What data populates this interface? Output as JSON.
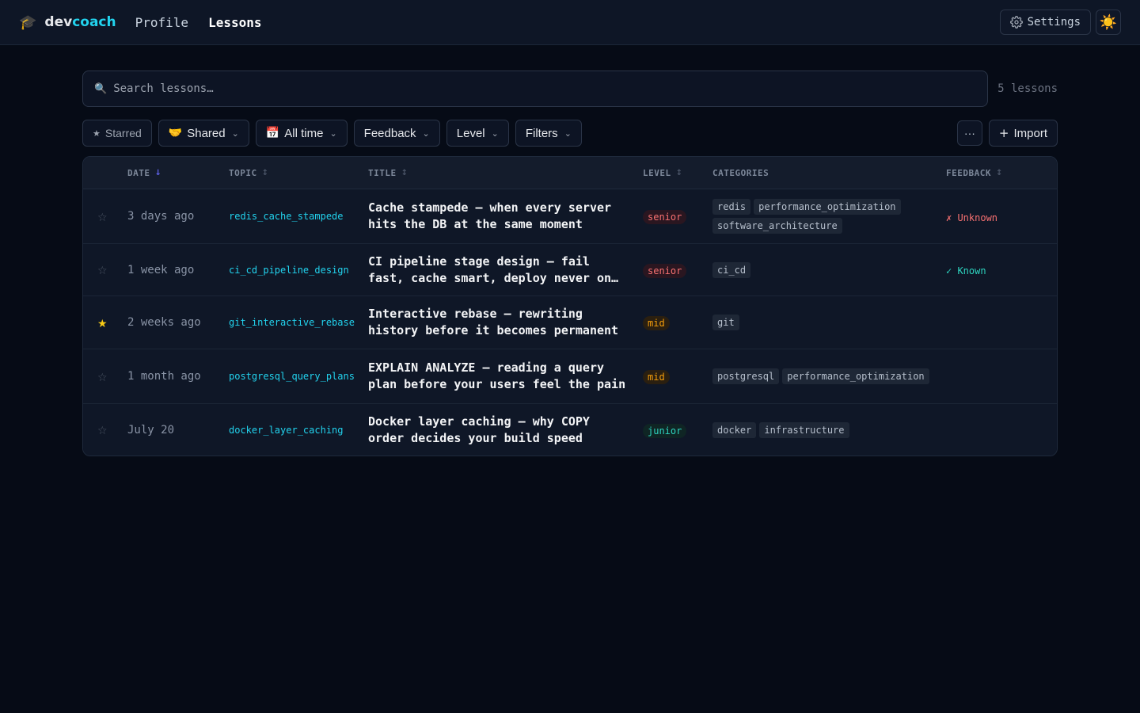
{
  "nav": {
    "brand_prefix": "dev",
    "brand_accent": "coach",
    "brand_icon": "graduation-cap-icon",
    "links": [
      "Profile",
      "Lessons"
    ],
    "active": "Lessons",
    "settings_label": "Settings",
    "theme_icon": "sun-icon"
  },
  "search": {
    "placeholder": "Search lessons…",
    "value": "",
    "count_label": "5 lessons"
  },
  "filters": {
    "starred": "Starred",
    "shared": "Shared",
    "time": "All time",
    "feedback": "Feedback",
    "level": "Level",
    "more_filters": "Filters",
    "more_icon": "···",
    "import": "Import"
  },
  "table": {
    "headers": {
      "date": "DATE",
      "topic": "TOPIC",
      "title": "TITLE",
      "level": "LEVEL",
      "categories": "CATEGORIES",
      "feedback": "FEEDBACK"
    },
    "sort_active": "date",
    "rows": [
      {
        "starred": false,
        "date": "3 days ago",
        "topic": "redis_cache_stampede",
        "title": "Cache stampede — when every server hits the DB at the same moment",
        "level": "senior",
        "categories": [
          "redis",
          "performance_optimization",
          "software_architecture"
        ],
        "feedback": "✗ Unknown",
        "feedback_state": "unknown"
      },
      {
        "starred": false,
        "date": "1 week ago",
        "topic": "ci_cd_pipeline_design",
        "title": "CI pipeline stage design — fail fast, cache smart, deploy never on Friday",
        "level": "senior",
        "categories": [
          "ci_cd"
        ],
        "feedback": "✓ Known",
        "feedback_state": "known"
      },
      {
        "starred": true,
        "date": "2 weeks ago",
        "topic": "git_interactive_rebase",
        "title": "Interactive rebase — rewriting history before it becomes permanent",
        "level": "mid",
        "categories": [
          "git"
        ],
        "feedback": "",
        "feedback_state": "none"
      },
      {
        "starred": false,
        "date": "1 month ago",
        "topic": "postgresql_query_plans",
        "title": "EXPLAIN ANALYZE — reading a query plan before your users feel the pain",
        "level": "mid",
        "categories": [
          "postgresql",
          "performance_optimization"
        ],
        "feedback": "",
        "feedback_state": "none"
      },
      {
        "starred": false,
        "date": "July 20",
        "topic": "docker_layer_caching",
        "title": "Docker layer caching — why COPY order decides your build speed",
        "level": "junior",
        "categories": [
          "docker",
          "infrastructure"
        ],
        "feedback": "",
        "feedback_state": "none"
      }
    ]
  },
  "colors": {
    "background": "#060b16",
    "accent": "#22d3ee",
    "senior": "#f87171",
    "mid": "#f59e0b",
    "junior": "#2dd4bf",
    "star_active": "#facc15"
  }
}
